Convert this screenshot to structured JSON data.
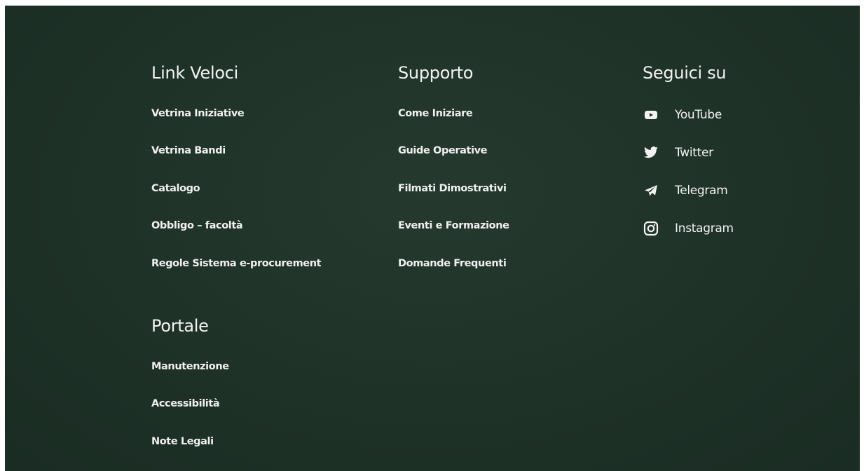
{
  "footer": {
    "link_veloci": {
      "heading": "Link Veloci",
      "items": [
        {
          "label": "Vetrina Iniziative"
        },
        {
          "label": "Vetrina Bandi"
        },
        {
          "label": "Catalogo"
        },
        {
          "label": "Obbligo – facoltà"
        },
        {
          "label": "Regole Sistema e-procurement"
        }
      ]
    },
    "supporto": {
      "heading": "Supporto",
      "items": [
        {
          "label": "Come Iniziare"
        },
        {
          "label": "Guide Operative"
        },
        {
          "label": "Filmati Dimostrativi"
        },
        {
          "label": "Eventi e Formazione"
        },
        {
          "label": "Domande Frequenti"
        }
      ]
    },
    "portale": {
      "heading": "Portale",
      "items": [
        {
          "label": "Manutenzione"
        },
        {
          "label": "Accessibilità"
        },
        {
          "label": "Note Legali"
        }
      ]
    },
    "seguici": {
      "heading": "Seguici su",
      "items": [
        {
          "label": "YouTube",
          "icon": "youtube-icon"
        },
        {
          "label": "Twitter",
          "icon": "twitter-icon"
        },
        {
          "label": "Telegram",
          "icon": "telegram-icon"
        },
        {
          "label": "Instagram",
          "icon": "instagram-icon"
        }
      ]
    }
  },
  "colors": {
    "background": "#1f3328",
    "text": "#f0f0f0"
  }
}
